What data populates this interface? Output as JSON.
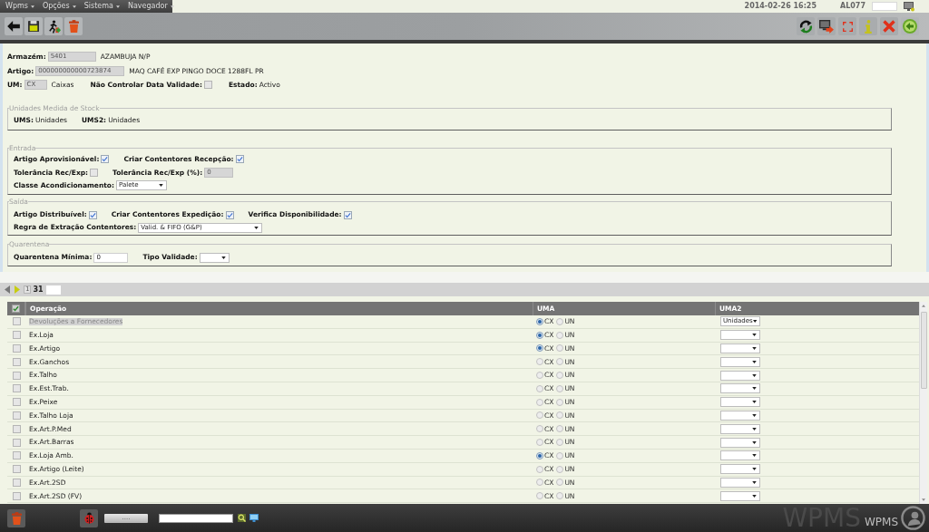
{
  "menu_bar": {
    "menus": [
      "Wpms",
      "Opções",
      "Sistema",
      "Navegador"
    ],
    "datetime": "2014-02-26 16:25",
    "user": "AL077"
  },
  "header_rows": [
    {
      "items": [
        {
          "kind": "input",
          "label": "Armazém:",
          "value": "5401",
          "disabled": true,
          "description": "AZAMBUJA N/P"
        }
      ]
    },
    {
      "items": [
        {
          "kind": "input",
          "label": "Artigo:",
          "value": "000000000000723874",
          "disabled": true,
          "description": "MAQ CAFÉ EXP PINGO DOCE 1288FL PR"
        }
      ]
    },
    {
      "items": [
        {
          "kind": "input",
          "label": "UM:",
          "value": "CX",
          "disabled": true,
          "description": "Caixas"
        },
        {
          "kind": "checkbox",
          "label": "Não Controlar Data Validade:",
          "checked": false
        },
        {
          "kind": "text",
          "label": "Estado:",
          "value": "Activo"
        }
      ]
    }
  ],
  "sections": [
    {
      "legend": "Unidades Medida de Stock",
      "rows": [
        {
          "items": [
            {
              "kind": "text",
              "label": "UMS:",
              "value": "Unidades"
            },
            {
              "kind": "text",
              "label": "UMS2:",
              "value": "Unidades"
            }
          ]
        }
      ]
    },
    {
      "legend": "Entrada",
      "rows": [
        {
          "items": [
            {
              "kind": "checkbox",
              "label": "Artigo Aprovisionável:",
              "checked": true
            },
            {
              "kind": "checkbox",
              "label": "Criar Contentores Recepção:",
              "checked": true
            }
          ]
        },
        {
          "items": [
            {
              "kind": "checkbox",
              "label": "Tolerância Rec/Exp:",
              "checked": false
            },
            {
              "kind": "input",
              "label": "Tolerância Rec/Exp (%):",
              "value": "0",
              "disabled": true
            }
          ]
        },
        {
          "items": [
            {
              "kind": "select",
              "label": "Classe Acondicionamento:",
              "value": "Palete"
            }
          ]
        }
      ]
    },
    {
      "legend": "Saída",
      "rows": [
        {
          "items": [
            {
              "kind": "checkbox",
              "label": "Artigo Distribuível:",
              "checked": true
            },
            {
              "kind": "checkbox",
              "label": "Criar Contentores Expedição:",
              "checked": true
            },
            {
              "kind": "checkbox",
              "label": "Verifica Disponibilidade:",
              "checked": true
            }
          ]
        },
        {
          "items": [
            {
              "kind": "select",
              "label": "Regra de Extração Contentores:",
              "value": "Valid. & FIFO (G&P)"
            }
          ]
        }
      ]
    },
    {
      "legend": "Quarentena",
      "rows": [
        {
          "items": [
            {
              "kind": "input",
              "label": "Quarentena Mínima:",
              "value": "0",
              "disabled": false
            },
            {
              "kind": "select",
              "label": "Tipo Validade:"
            }
          ]
        }
      ]
    }
  ],
  "pagination": {
    "page": "1",
    "total": "31"
  },
  "table": {
    "header_checked": true,
    "columns": [
      "Operação",
      "UMA",
      "UMA2"
    ],
    "rows": [
      {
        "checked": false,
        "highlighted": true,
        "operation": "Devoluções a Fornecedores",
        "uma": [
          {
            "label": "CX",
            "selected": true
          },
          {
            "label": "UN",
            "selected": false
          }
        ],
        "uma2": "Unidades"
      },
      {
        "checked": false,
        "highlighted": false,
        "operation": "Ex.Loja",
        "uma": [
          {
            "label": "CX",
            "selected": true
          },
          {
            "label": "UN",
            "selected": false
          }
        ]
      },
      {
        "checked": false,
        "highlighted": false,
        "operation": "Ex.Artigo",
        "uma": [
          {
            "label": "CX",
            "selected": true
          },
          {
            "label": "UN",
            "selected": false
          }
        ]
      },
      {
        "checked": false,
        "highlighted": false,
        "operation": "Ex.Ganchos",
        "uma": [
          {
            "label": "CX",
            "selected": false
          },
          {
            "label": "UN",
            "selected": false
          }
        ]
      },
      {
        "checked": false,
        "highlighted": false,
        "operation": "Ex.Talho",
        "uma": [
          {
            "label": "CX",
            "selected": false
          },
          {
            "label": "UN",
            "selected": false
          }
        ]
      },
      {
        "checked": false,
        "highlighted": false,
        "operation": "Ex.Est.Trab.",
        "uma": [
          {
            "label": "CX",
            "selected": false
          },
          {
            "label": "UN",
            "selected": false
          }
        ]
      },
      {
        "checked": false,
        "highlighted": false,
        "operation": "Ex.Peixe",
        "uma": [
          {
            "label": "CX",
            "selected": false
          },
          {
            "label": "UN",
            "selected": false
          }
        ]
      },
      {
        "checked": false,
        "highlighted": false,
        "operation": "Ex.Talho Loja",
        "uma": [
          {
            "label": "CX",
            "selected": false
          },
          {
            "label": "UN",
            "selected": false
          }
        ]
      },
      {
        "checked": false,
        "highlighted": false,
        "operation": "Ex.Art.P.Med",
        "uma": [
          {
            "label": "CX",
            "selected": false
          },
          {
            "label": "UN",
            "selected": false
          }
        ]
      },
      {
        "checked": false,
        "highlighted": false,
        "operation": "Ex.Art.Barras",
        "uma": [
          {
            "label": "CX",
            "selected": false
          },
          {
            "label": "UN",
            "selected": false
          }
        ]
      },
      {
        "checked": false,
        "highlighted": false,
        "operation": "Ex.Loja Amb.",
        "uma": [
          {
            "label": "CX",
            "selected": true
          },
          {
            "label": "UN",
            "selected": false
          }
        ]
      },
      {
        "checked": false,
        "highlighted": false,
        "operation": "Ex.Artigo (Leite)",
        "uma": [
          {
            "label": "CX",
            "selected": false
          },
          {
            "label": "UN",
            "selected": false
          }
        ]
      },
      {
        "checked": false,
        "highlighted": false,
        "operation": "Ex.Art.2SD",
        "uma": [
          {
            "label": "CX",
            "selected": false
          },
          {
            "label": "UN",
            "selected": false
          }
        ]
      },
      {
        "checked": false,
        "highlighted": false,
        "operation": "Ex.Art.2SD (FV)",
        "uma": [
          {
            "label": "CX",
            "selected": false
          },
          {
            "label": "UN",
            "selected": false
          }
        ]
      }
    ]
  },
  "bottom_bar": {
    "button_label": "....",
    "logo": {
      "backdrop_text": "WPMS",
      "text": "WPMS"
    }
  }
}
